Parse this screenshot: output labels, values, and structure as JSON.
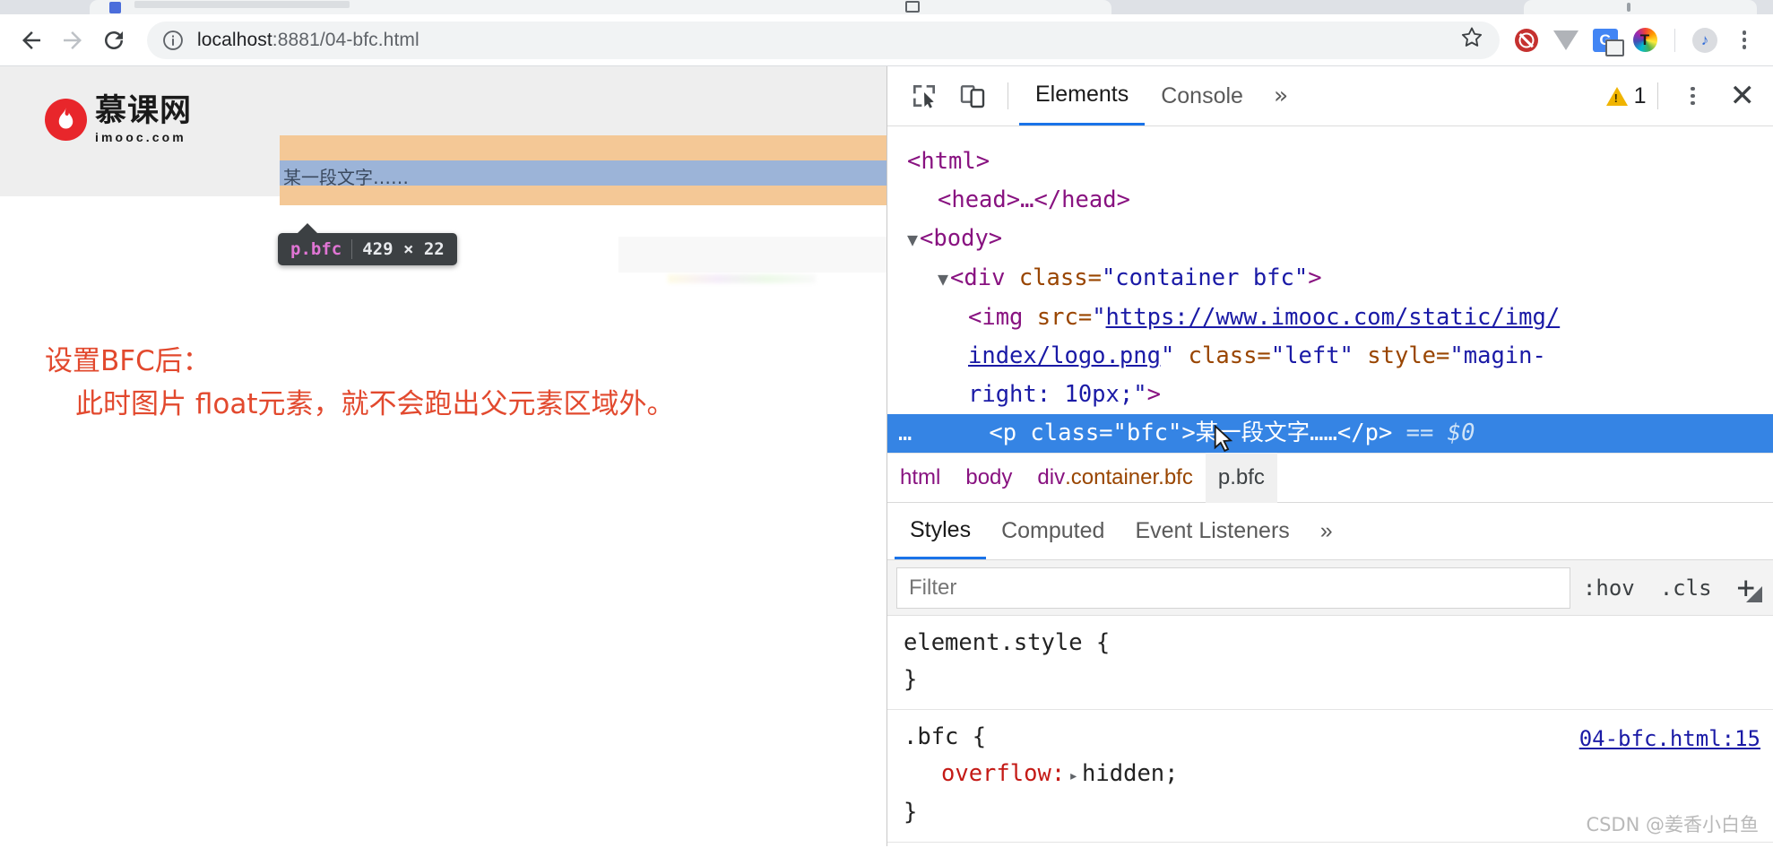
{
  "browser": {
    "back_label": "back-arrow",
    "forward_label": "forward-arrow",
    "reload_label": "reload",
    "url_host": "localhost",
    "url_path": ":8881/04-bfc.html",
    "url_full": "localhost:8881/04-bfc.html",
    "extensions": [
      {
        "name": "bookmark-star-icon",
        "glyph": "☆"
      },
      {
        "name": "adblock-extension-icon",
        "glyph": ""
      },
      {
        "name": "vimium-extension-icon",
        "glyph": ""
      },
      {
        "name": "google-translate-icon",
        "glyph": "G"
      },
      {
        "name": "rainbow-t-extension-icon",
        "glyph": "T"
      },
      {
        "name": "music-extension-icon",
        "glyph": "♪"
      }
    ],
    "menu_label": "chrome-menu"
  },
  "page": {
    "logo_cn": "慕课网",
    "logo_en": "imooc.com",
    "paragraph_text": "某一段文字……",
    "tooltip_selector": "p.bfc",
    "tooltip_dimensions": "429 × 22",
    "note_line1": "设置BFC后：",
    "note_line2": "此时图片 float元素，就不会跑出父元素区域外。",
    "note_color": "#e2492e",
    "highlight_content_color": "#9cb4d8",
    "highlight_padding_color": "#f4c896"
  },
  "devtools": {
    "toolbar": {
      "inspect_label": "inspect-element",
      "device_label": "toggle-device-toolbar",
      "warning_count": "1",
      "close_label": "✕"
    },
    "tabs": [
      {
        "label": "Elements",
        "active": true
      },
      {
        "label": "Console",
        "active": false
      }
    ],
    "more_tabs_glyph": "»",
    "dom": {
      "rows": [
        {
          "text": "<html>"
        },
        {
          "text": "<head>…</head>"
        },
        {
          "text": "<body>"
        },
        {
          "text": "<div class=\"container bfc\">"
        },
        {
          "text": "<img src=\"https://www.imooc.com/static/img/index/logo.png\" class=\"left\" style=\"magin-right: 10px;\">"
        },
        {
          "text": "<p class=\"bfc\">某一段文字……</p>"
        }
      ],
      "html_tag": "<html>",
      "head_tag": "<head>…</head>",
      "body_tag": "<body>",
      "div_tag_open": "<div ",
      "div_attr": "class=",
      "div_val": "\"container bfc\"",
      "div_close": ">",
      "img_tag_open": "<img ",
      "img_attr_src": "src=",
      "img_url_part1": "https://www.imooc.com/static/img/",
      "img_url_part2": "index/logo.png",
      "img_attr_class": "class=",
      "img_val_class": "\"left\"",
      "img_attr_style": "style=",
      "img_val_style_1": "\"magin-",
      "img_val_style_2": "right: 10px;\"",
      "img_close": ">",
      "selected_ellipsis": "…",
      "selected_open": "<p ",
      "selected_attr": "class=",
      "selected_val": "\"bfc\"",
      "selected_gt": ">",
      "selected_text": "某一段文字……",
      "selected_closetag": "</p>",
      "selected_eq": "==",
      "selected_dollar": "$0"
    },
    "breadcrumb": [
      {
        "label": "html",
        "active": false
      },
      {
        "label": "body",
        "active": false
      },
      {
        "label": "div.container.bfc",
        "active": false
      },
      {
        "label": "p.bfc",
        "active": true
      }
    ],
    "breadcrumb_div_tag": "div",
    "breadcrumb_div_cls": ".container.bfc",
    "styles_tabs": [
      {
        "label": "Styles",
        "active": true
      },
      {
        "label": "Computed",
        "active": false
      },
      {
        "label": "Event Listeners",
        "active": false
      }
    ],
    "styles_more_glyph": "»",
    "filter": {
      "placeholder": "Filter",
      "value": "",
      "hov_label": ":hov",
      "cls_label": ".cls",
      "plus_label": "+"
    },
    "rules": [
      {
        "selector": "element.style {",
        "close": "}",
        "source": "",
        "declarations": []
      },
      {
        "selector": ".bfc {",
        "close": "}",
        "source": "04-bfc.html:15",
        "declarations": [
          {
            "property": "overflow",
            "value": "hidden",
            "expandable": true
          }
        ]
      }
    ],
    "rule1_selector": "element.style {",
    "rule1_close": "}",
    "rule2_selector": ".bfc {",
    "rule2_close": "}",
    "rule2_source": "04-bfc.html:15",
    "rule2_prop": "overflow",
    "rule2_colon": ":",
    "rule2_value": "hidden;",
    "watermark": "CSDN @姜香小白鱼"
  }
}
